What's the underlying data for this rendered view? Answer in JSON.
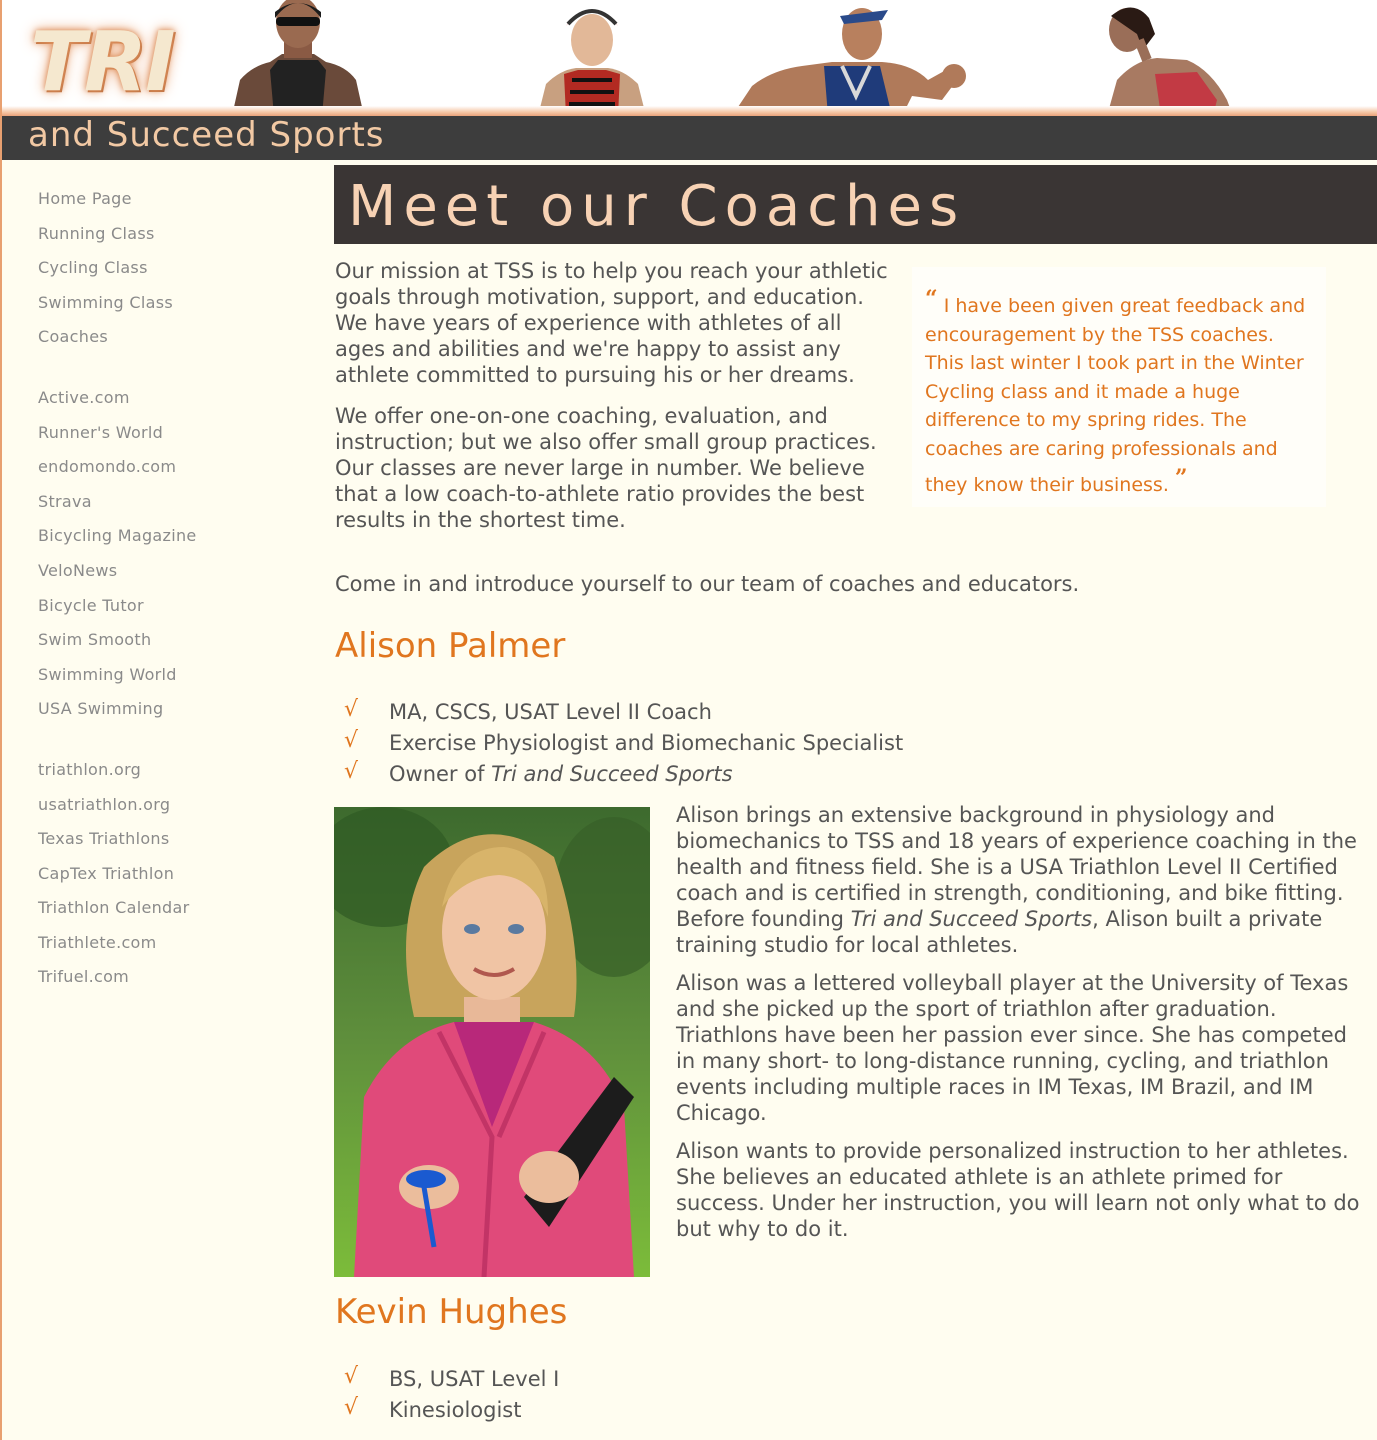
{
  "header": {
    "logo_main": "TRI",
    "logo_sub": "and Succeed Sports"
  },
  "sidebar": {
    "groups": [
      {
        "items": [
          {
            "label": "Home Page"
          },
          {
            "label": "Running Class"
          },
          {
            "label": "Cycling Class"
          },
          {
            "label": "Swimming Class"
          },
          {
            "label": "Coaches"
          }
        ]
      },
      {
        "items": [
          {
            "label": "Active.com"
          },
          {
            "label": "Runner's World"
          },
          {
            "label": "endomondo.com"
          },
          {
            "label": "Strava"
          },
          {
            "label": "Bicycling Magazine"
          },
          {
            "label": "VeloNews"
          },
          {
            "label": "Bicycle Tutor"
          },
          {
            "label": "Swim Smooth"
          },
          {
            "label": "Swimming World"
          },
          {
            "label": "USA Swimming"
          }
        ]
      },
      {
        "items": [
          {
            "label": "triathlon.org"
          },
          {
            "label": "usatriathlon.org"
          },
          {
            "label": "Texas Triathlons"
          },
          {
            "label": "CapTex Triathlon"
          },
          {
            "label": "Triathlon Calendar"
          },
          {
            "label": "Triathlete.com"
          },
          {
            "label": "Trifuel.com"
          }
        ]
      }
    ]
  },
  "main": {
    "title": "Meet our Coaches",
    "intro": [
      "Our mission at TSS is to help you reach your athletic goals through motivation, support, and education. We have years of experience with athletes of all ages and abilities and we're happy to assist any athlete committed to pursuing his or her dreams.",
      "We offer one-on-one coaching, evaluation, and instruction; but we also offer small group practices. Our classes are never large in number. We believe that a low coach-to-athlete ratio provides the best results in the shortest time."
    ],
    "invite": "Come in and introduce yourself to our team of coaches and educators.",
    "quote": {
      "open_mark": "“",
      "text": "I have been given great feedback and encouragement by the TSS coaches. This last winter I took part in the Winter Cycling class and it made a huge difference to my spring rides. The coaches are caring professionals and they know their business.",
      "close_mark": "”"
    },
    "check_glyph": "√",
    "coaches": [
      {
        "name": "Alison Palmer",
        "credentials": [
          "MA, CSCS, USAT Level II Coach",
          "Exercise Physiologist and Biomechanic Specialist"
        ],
        "owner_prefix": "Owner of ",
        "owner_company": "Tri and Succeed Sports",
        "bio_p1_a": "Alison brings an extensive background in physiology and biomechanics to TSS and 18 years of experience coaching in the health and fitness field. She is a USA Triathlon Level II Certified coach and is certified in strength, conditioning, and bike fitting. Before founding ",
        "bio_p1_company": "Tri and Succeed Sports",
        "bio_p1_b": ", Alison built a private training studio for local athletes.",
        "bio_p2": "Alison was a lettered volleyball player at the University of Texas and she picked up the sport of triathlon after graduation. Triathlons have been her passion ever since. She has competed in many short- to long-distance running, cycling, and triathlon events including multiple races in IM Texas, IM Brazil, and IM Chicago.",
        "bio_p3": "Alison wants to provide personalized instruction to her athletes. She believes an educated athlete is an athlete primed for success. Under her instruction, you will learn not only what to do but why to do it."
      },
      {
        "name": "Kevin Hughes",
        "credentials": [
          "BS, USAT Level I",
          "Kinesiologist"
        ]
      }
    ]
  },
  "colors": {
    "accent": "#e0761f",
    "title_bar": "#3a3534",
    "header_bar": "#3d3d3d",
    "background": "#fffdf0",
    "nav_text": "#8a8a8a"
  }
}
